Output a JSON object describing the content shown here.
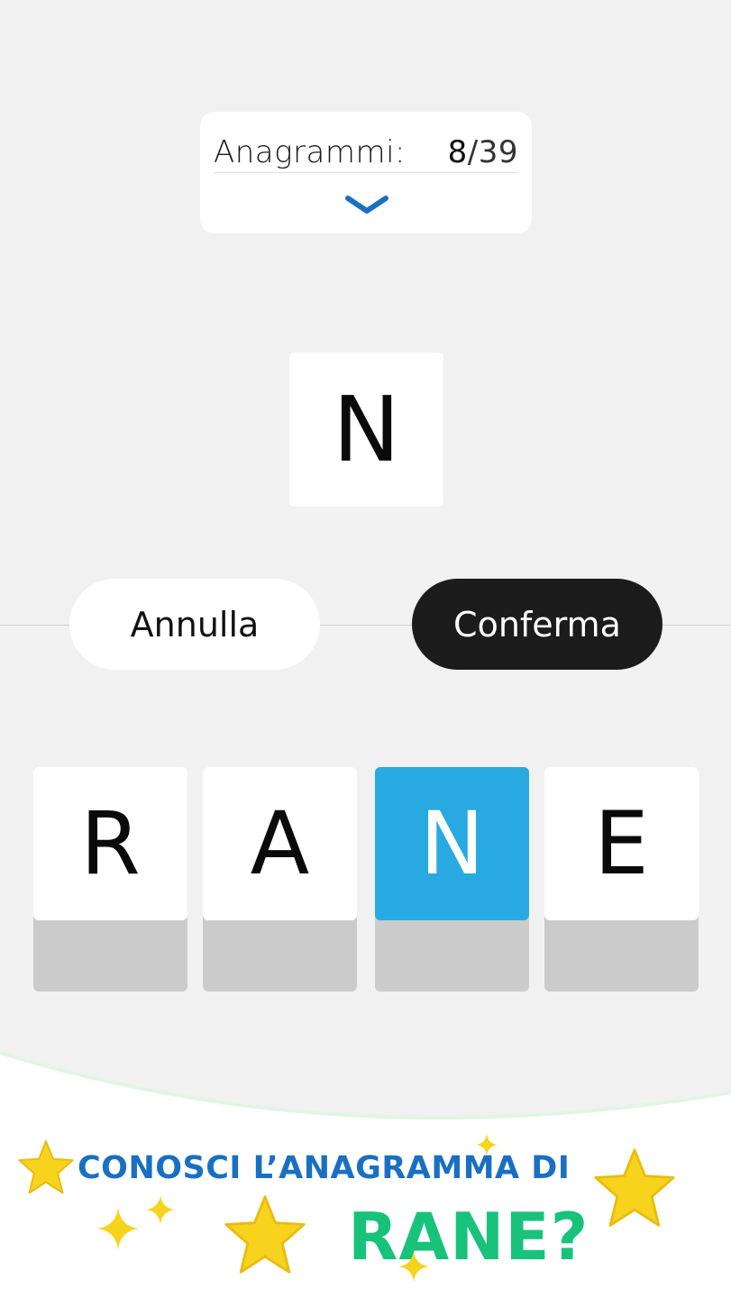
{
  "counter": {
    "label": "Anagrammi:",
    "found": "8",
    "separator": "/",
    "total": "39"
  },
  "current_word": {
    "letters": "N"
  },
  "actions": {
    "cancel_label": "Annulla",
    "confirm_label": "Conferma"
  },
  "keys": [
    {
      "letter": "R",
      "selected": false
    },
    {
      "letter": "A",
      "selected": false
    },
    {
      "letter": "N",
      "selected": true
    },
    {
      "letter": "E",
      "selected": false
    }
  ],
  "promo": {
    "line1": "CONOSCI L’ANAGRAMMA DI",
    "line2": "RANE?"
  },
  "colors": {
    "background": "#f1f1f1",
    "selected_key": "#29a9e1",
    "confirm_button": "#1c1c1c",
    "chevron": "#1a6fc2",
    "promo_blue": "#1a6fc2",
    "promo_green": "#19c27a",
    "star_yellow": "#f7d31e"
  },
  "icons": {
    "expand": "chevron-down-icon",
    "decoration": "star-icon"
  }
}
